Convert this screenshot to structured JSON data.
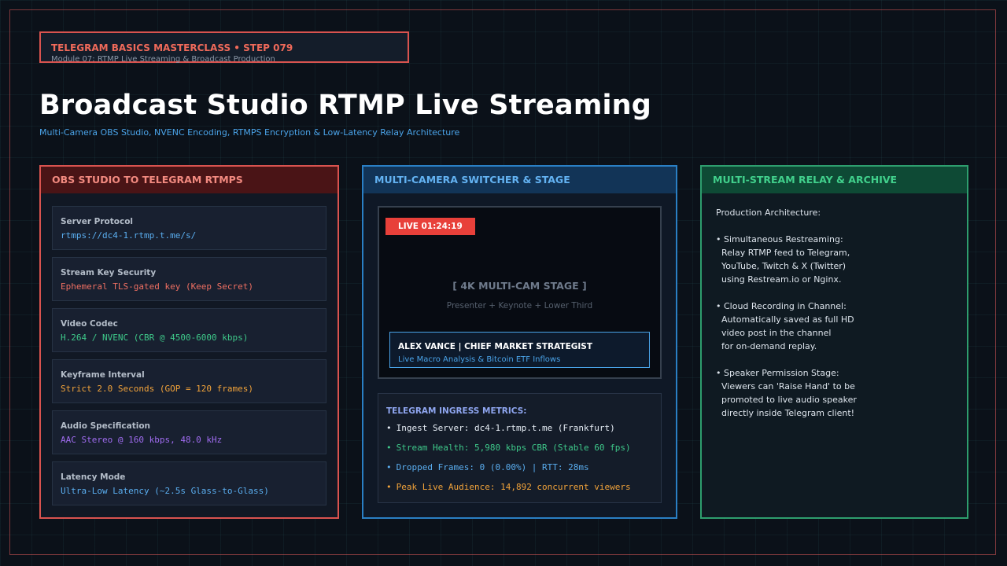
{
  "header": {
    "step_title": "TELEGRAM BASICS MASTERCLASS • STEP 079",
    "step_subtitle": "Module 07: RTMP Live Streaming & Broadcast Production",
    "title": "Broadcast Studio RTMP Live Streaming",
    "subtitle": "Multi-Camera OBS Studio, NVENC Encoding, RTMPS Encryption & Low-Latency Relay Architecture"
  },
  "panel_obs": {
    "icon": "",
    "title": "OBS STUDIO TO TELEGRAM RTMPS",
    "specs": [
      {
        "label": "Server Protocol",
        "value": "rtmps://dc4-1.rtmp.t.me/s/",
        "color": "#5aaef0"
      },
      {
        "label": "Stream Key Security",
        "value": "Ephemeral TLS-gated key (Keep Secret)",
        "color": "#ef6f62"
      },
      {
        "label": "Video Codec",
        "value": "H.264 / NVENC (CBR @ 4500-6000 kbps)",
        "color": "#3ec98a"
      },
      {
        "label": "Keyframe Interval",
        "value": "Strict 2.0 Seconds (GOP = 120 frames)",
        "color": "#f2a33a"
      },
      {
        "label": "Audio Specification",
        "value": "AAC Stereo @ 160 kbps, 48.0 kHz",
        "color": "#a06cf0"
      },
      {
        "label": "Latency Mode",
        "value": "Ultra-Low Latency (~2.5s Glass-to-Glass)",
        "color": "#5aaef0"
      }
    ]
  },
  "panel_switcher": {
    "icon": "",
    "title": "MULTI-CAMERA SWITCHER & STAGE",
    "live_badge": "LIVE 01:24:19",
    "stage_title": "[ 4K MULTI-CAM STAGE ]",
    "stage_subtitle": "Presenter + Keynote + Lower Third",
    "lower_third_name": "ALEX VANCE | CHIEF MARKET STRATEGIST",
    "lower_third_desc": "Live Macro Analysis & Bitcoin ETF Inflows",
    "metrics_title": "TELEGRAM INGRESS METRICS:",
    "metrics": [
      {
        "bullet": "•",
        "text": "Ingest Server: dc4-1.rtmp.t.me (Frankfurt)",
        "color": "#e6edf5"
      },
      {
        "bullet": "•",
        "text": "Stream Health: 5,980 kbps CBR (Stable 60 fps)",
        "color": "#3ec98a"
      },
      {
        "bullet": "•",
        "text": "Dropped Frames: 0 (0.00%) | RTT: 28ms",
        "color": "#5aaef0"
      },
      {
        "bullet": "•",
        "text": "Peak Live Audience: 14,892 concurrent viewers",
        "color": "#f2a33a"
      }
    ]
  },
  "panel_relay": {
    "icon": "",
    "title": "MULTI-STREAM RELAY & ARCHIVE",
    "lines": [
      "Production Architecture:",
      "",
      "• Simultaneous Restreaming:",
      "  Relay RTMP feed to Telegram,",
      "  YouTube, Twitch & X (Twitter)",
      "  using Restream.io or Nginx.",
      "",
      "• Cloud Recording in Channel:",
      "  Automatically saved as full HD",
      "  video post in the channel",
      "  for on-demand replay.",
      "",
      "• Speaker Permission Stage:",
      "  Viewers can 'Raise Hand' to be",
      "  promoted to live audio speaker",
      "  directly inside Telegram client!"
    ]
  }
}
